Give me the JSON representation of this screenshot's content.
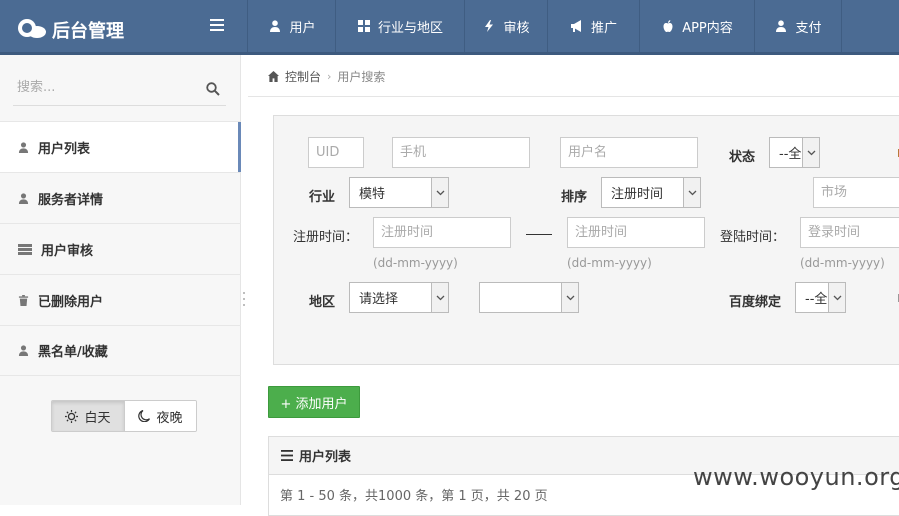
{
  "brand": {
    "title": "后台管理"
  },
  "nav": [
    {
      "label": "用户",
      "icon": "user-icon"
    },
    {
      "label": "行业与地区",
      "icon": "grid-icon"
    },
    {
      "label": "审核",
      "icon": "bolt-icon"
    },
    {
      "label": "推广",
      "icon": "bullhorn-icon"
    },
    {
      "label": "APP内容",
      "icon": "apple-icon"
    },
    {
      "label": "支付",
      "icon": "user-icon"
    }
  ],
  "sidebar": {
    "search_placeholder": "搜索...",
    "items": [
      {
        "label": "用户列表",
        "icon": "user-icon",
        "active": true
      },
      {
        "label": "服务者详情",
        "icon": "user-icon"
      },
      {
        "label": "用户审核",
        "icon": "list-icon"
      },
      {
        "label": "已删除用户",
        "icon": "trash-icon"
      },
      {
        "label": "黑名单/收藏",
        "icon": "user-icon"
      }
    ],
    "theme": {
      "day": "白天",
      "night": "夜晚",
      "selected": "day"
    }
  },
  "breadcrumb": {
    "home": "控制台",
    "current": "用户搜索"
  },
  "filters": {
    "uid_placeholder": "UID",
    "phone_placeholder": "手机",
    "username_placeholder": "用户名",
    "status_label": "状态",
    "status_value": "--全",
    "industry_label": "行业",
    "industry_value": "模特",
    "sort_label": "排序",
    "sort_value": "注册时间",
    "market_placeholder": "市场",
    "reg_time_label": "注册时间：",
    "reg_start_placeholder": "注册时间",
    "reg_end_placeholder": "注册时间",
    "reg_start_hint": "(dd-mm-yyyy)",
    "reg_end_hint": "(dd-mm-yyyy)",
    "login_time_label": "登陆时间：",
    "login_placeholder": "登录时间",
    "login_hint": "(dd-mm-yyyy)",
    "region_label": "地区",
    "region_value": "请选择",
    "region2_value": "",
    "baidu_label": "百度绑定",
    "baidu_value": "--全"
  },
  "actions": {
    "add_user": "+ 添加用户"
  },
  "list": {
    "title": "用户列表",
    "summary": "第 1 - 50 条，共1000 条，第 1 页，共 20 页"
  },
  "watermark": "www.wooyun.org",
  "colors": {
    "header": "#4b6b93",
    "accent": "#6a89b8",
    "add_button": "#4cae4c"
  }
}
